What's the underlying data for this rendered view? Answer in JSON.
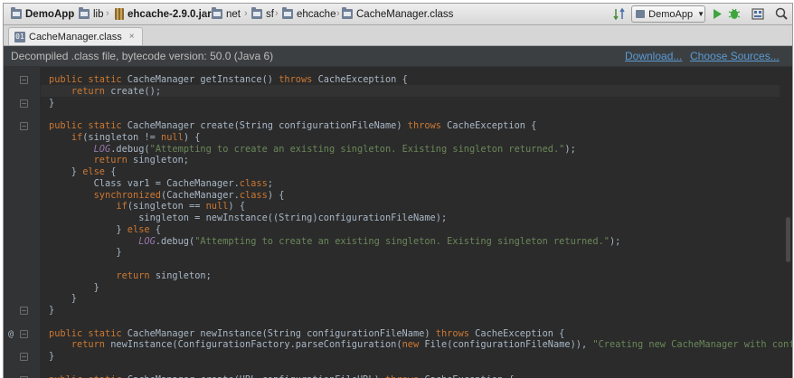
{
  "breadcrumbs": [
    {
      "label": "DemoApp",
      "bold": true
    },
    {
      "label": "lib"
    },
    {
      "label": "ehcache-2.9.0.jar",
      "bold": true
    },
    {
      "label": "net"
    },
    {
      "label": "sf"
    },
    {
      "label": "ehcache"
    },
    {
      "label": "CacheManager.class"
    }
  ],
  "toolbar": {
    "run_config": "DemoApp",
    "icons": [
      "sort-icon",
      "run-icon",
      "debug-icon",
      "project-structure-icon",
      "search-icon"
    ]
  },
  "tab": {
    "label": "CacheManager.class",
    "close": "×"
  },
  "banner": {
    "message": "Decompiled .class file, bytecode version: 50.0 (Java 6)",
    "download": "Download...",
    "choose_sources": "Choose Sources..."
  },
  "gutter": {
    "override_marker": "@"
  },
  "code": [
    [
      [
        "kw",
        "public static "
      ],
      [
        "t",
        "CacheManager getInstance() "
      ],
      [
        "kw",
        "throws "
      ],
      [
        "t",
        "CacheException {"
      ]
    ],
    [
      [
        "t",
        "    "
      ],
      [
        "kw",
        "return "
      ],
      [
        "t",
        "create();"
      ]
    ],
    [
      [
        "t",
        "}"
      ]
    ],
    [],
    [
      [
        "kw",
        "public static "
      ],
      [
        "t",
        "CacheManager create(String configurationFileName) "
      ],
      [
        "kw",
        "throws "
      ],
      [
        "t",
        "CacheException {"
      ]
    ],
    [
      [
        "t",
        "    "
      ],
      [
        "kw",
        "if"
      ],
      [
        "t",
        "(singleton != "
      ],
      [
        "kw",
        "null"
      ],
      [
        "t",
        ") {"
      ]
    ],
    [
      [
        "t",
        "        "
      ],
      [
        "fld",
        "LOG"
      ],
      [
        "t",
        ".debug("
      ],
      [
        "str",
        "\"Attempting to create an existing singleton. Existing singleton returned.\""
      ],
      [
        "t",
        ");"
      ]
    ],
    [
      [
        "t",
        "        "
      ],
      [
        "kw",
        "return "
      ],
      [
        "t",
        "singleton;"
      ]
    ],
    [
      [
        "t",
        "    } "
      ],
      [
        "kw",
        "else "
      ],
      [
        "t",
        "{"
      ]
    ],
    [
      [
        "t",
        "        Class var1 = CacheManager."
      ],
      [
        "kw",
        "class"
      ],
      [
        "t",
        ";"
      ]
    ],
    [
      [
        "t",
        "        "
      ],
      [
        "kw",
        "synchronized"
      ],
      [
        "t",
        "(CacheManager."
      ],
      [
        "kw",
        "class"
      ],
      [
        "t",
        ") {"
      ]
    ],
    [
      [
        "t",
        "            "
      ],
      [
        "kw",
        "if"
      ],
      [
        "t",
        "(singleton == "
      ],
      [
        "kw",
        "null"
      ],
      [
        "t",
        ") {"
      ]
    ],
    [
      [
        "t",
        "                singleton = newInstance((String)configurationFileName);"
      ]
    ],
    [
      [
        "t",
        "            } "
      ],
      [
        "kw",
        "else "
      ],
      [
        "t",
        "{"
      ]
    ],
    [
      [
        "t",
        "                "
      ],
      [
        "fld",
        "LOG"
      ],
      [
        "t",
        ".debug("
      ],
      [
        "str",
        "\"Attempting to create an existing singleton. Existing singleton returned.\""
      ],
      [
        "t",
        ");"
      ]
    ],
    [
      [
        "t",
        "            }"
      ]
    ],
    [],
    [
      [
        "t",
        "            "
      ],
      [
        "kw",
        "return "
      ],
      [
        "t",
        "singleton;"
      ]
    ],
    [
      [
        "t",
        "        }"
      ]
    ],
    [
      [
        "t",
        "    }"
      ]
    ],
    [
      [
        "t",
        "}"
      ]
    ],
    [],
    [
      [
        "kw",
        "public static "
      ],
      [
        "t",
        "CacheManager newInstance(String configurationFileName) "
      ],
      [
        "kw",
        "throws "
      ],
      [
        "t",
        "CacheException {"
      ]
    ],
    [
      [
        "t",
        "    "
      ],
      [
        "kw",
        "return "
      ],
      [
        "t",
        "newInstance(ConfigurationFactory.parseConfiguration("
      ],
      [
        "kw",
        "new "
      ],
      [
        "t",
        "File(configurationFileName)), "
      ],
      [
        "str",
        "\"Creating new CacheManager with config"
      ]
    ],
    [
      [
        "t",
        "}"
      ]
    ],
    [],
    [
      [
        "kw",
        "public static "
      ],
      [
        "t",
        "CacheManager create(URL configurationFileURL) "
      ],
      [
        "kw",
        "throws "
      ],
      [
        "t",
        "CacheException {"
      ]
    ]
  ],
  "colors": {
    "keyword": "#cc7832",
    "string": "#6a8759",
    "field": "#9876aa",
    "text": "#a9b7c6",
    "background": "#2b2b2b",
    "link": "#5a9bd5"
  }
}
